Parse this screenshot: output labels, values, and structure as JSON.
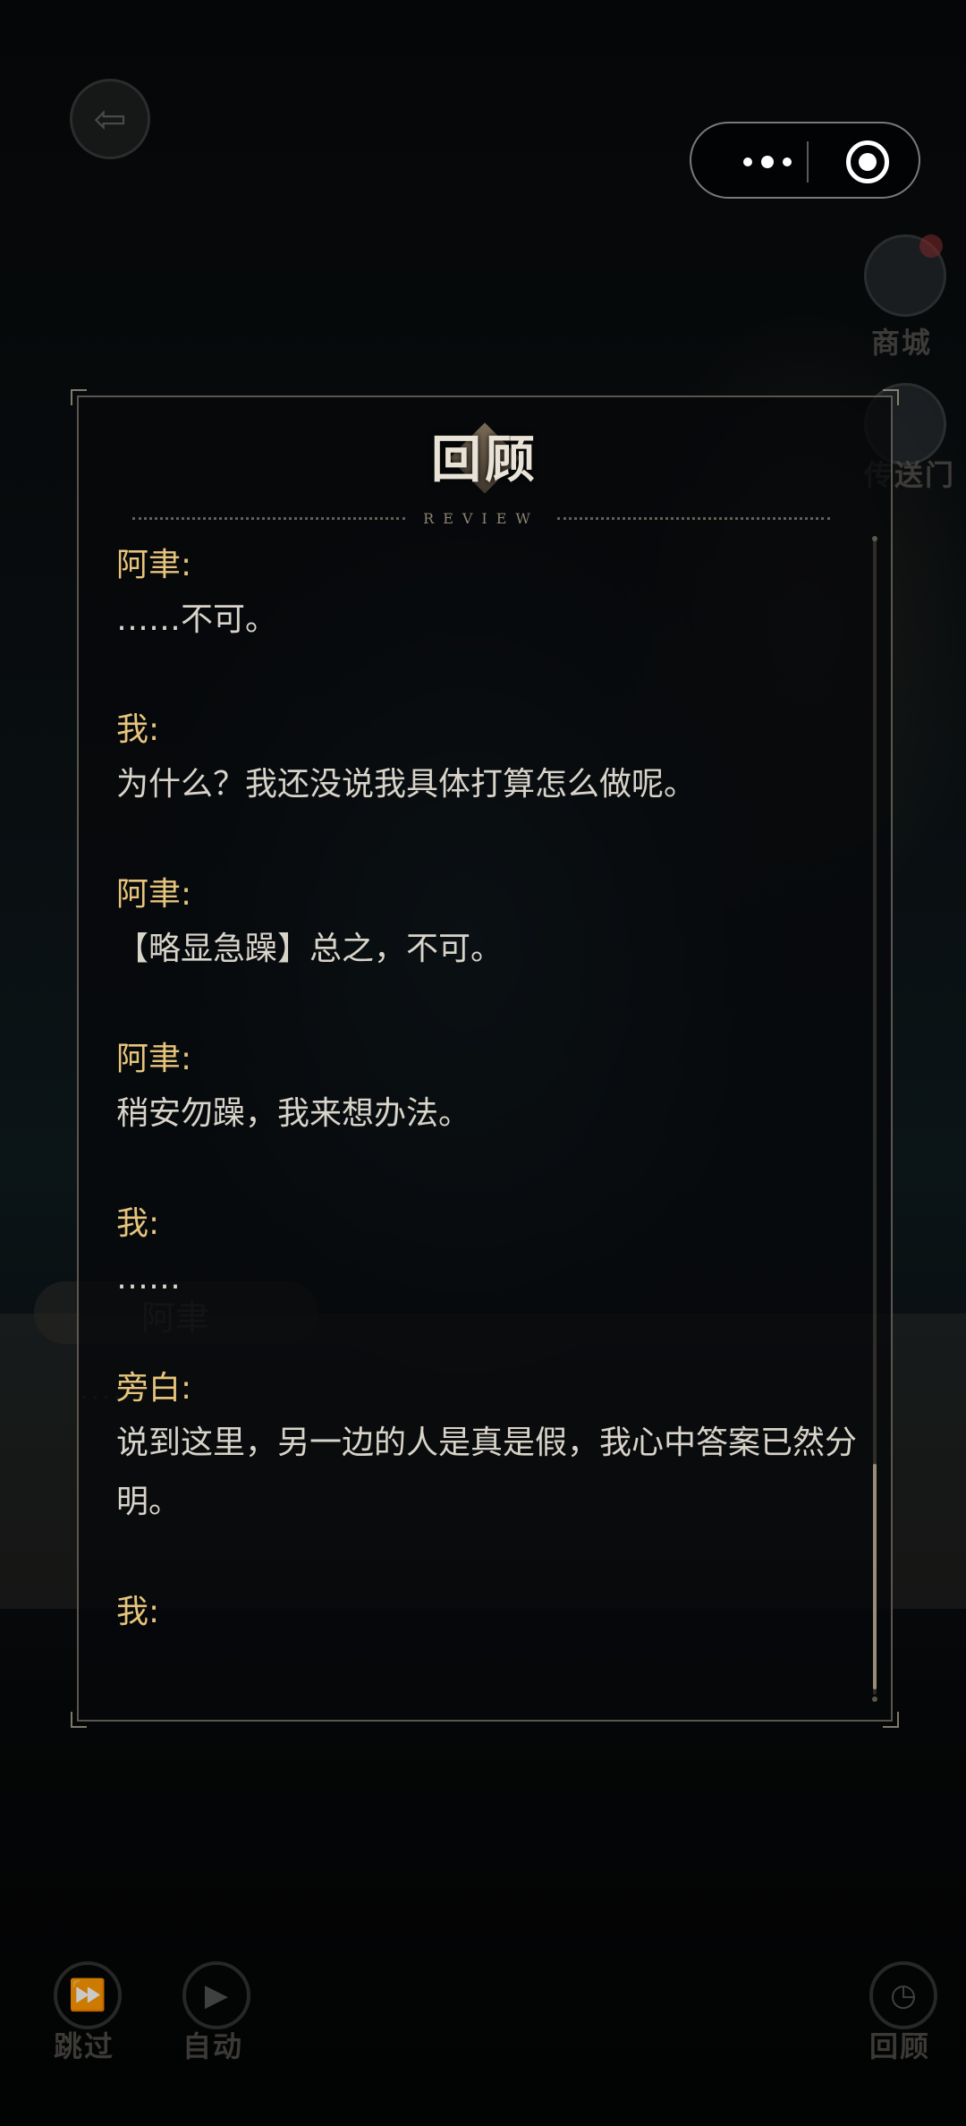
{
  "capsule": {
    "more_icon": "more-dots-icon",
    "close_icon": "mini-program-close-icon"
  },
  "background": {
    "nameplate": "阿聿",
    "dots": "······"
  },
  "hud": {
    "back_icon": "back-arrow-icon",
    "shop_label": "商城",
    "portal_label": "传送门",
    "skip_label": "跳过",
    "auto_label": "自动",
    "review_label": "回顾"
  },
  "panel": {
    "title": "回顾",
    "subtitle": "REVIEW",
    "entries": [
      {
        "speaker": "阿聿:",
        "text": "……不可。"
      },
      {
        "speaker": "我:",
        "text": "为什么？我还没说我具体打算怎么做呢。"
      },
      {
        "speaker": "阿聿:",
        "text": "【略显急躁】总之，不可。"
      },
      {
        "speaker": "阿聿:",
        "text": "稍安勿躁，我来想办法。"
      },
      {
        "speaker": "我:",
        "text": "……"
      },
      {
        "speaker": "旁白:",
        "text": "说到这里，另一边的人是真是假，我心中答案已然分明。"
      },
      {
        "speaker": "我:",
        "text": ""
      }
    ]
  },
  "colors": {
    "speaker": "#e7c47c",
    "text": "#d9d4ca",
    "frame": "#a09687"
  }
}
